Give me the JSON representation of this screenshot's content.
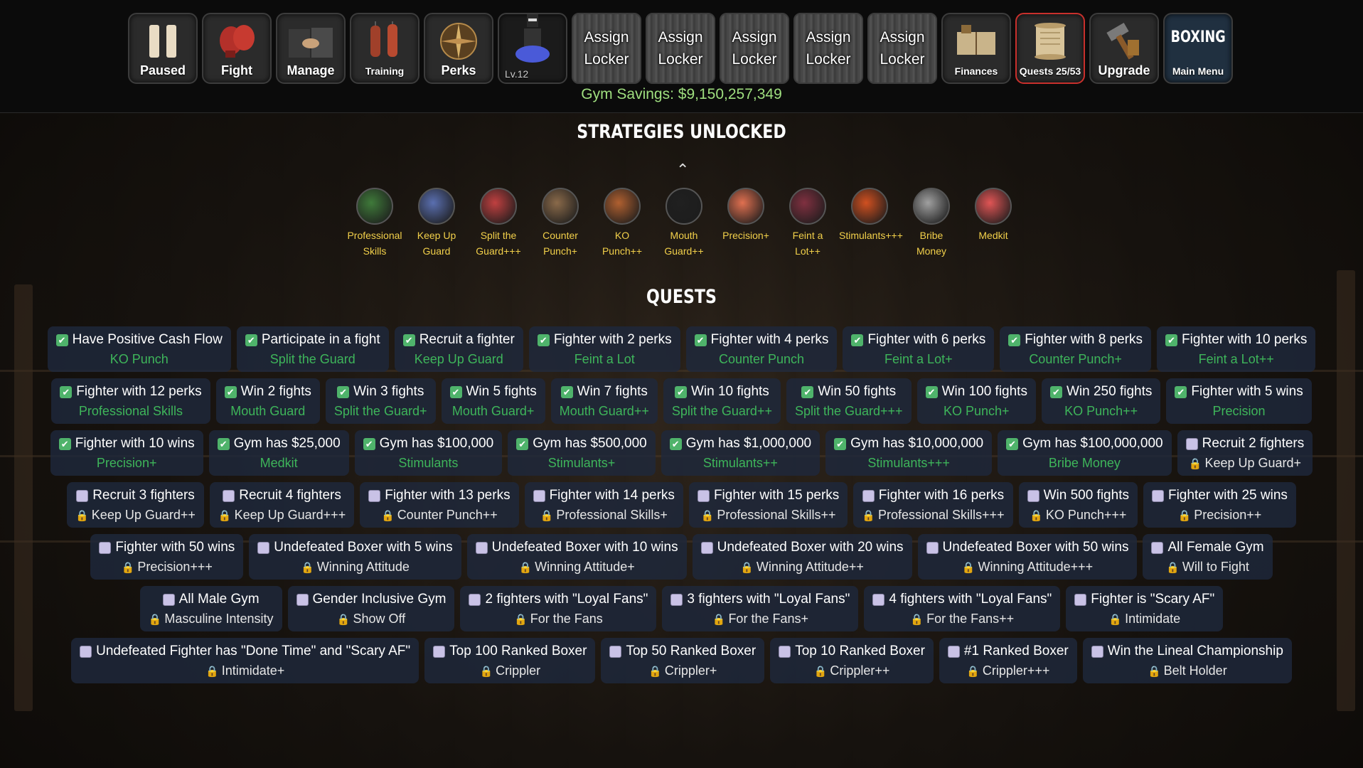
{
  "topbar": {
    "paused_label": "Paused",
    "fight_label": "Fight",
    "manage_label": "Manage",
    "training_label": "Training",
    "perks_label": "Perks",
    "level_label": "Lv.12",
    "locker_label": "Assign Locker",
    "finances_label": "Finances",
    "quests_label": "Quests 25/53",
    "upgrade_label": "Upgrade",
    "main_menu_label": "Main Menu",
    "logo_text": "BOXING",
    "savings": "Gym Savings: $9,150,257,349",
    "active_accent": "#c9302c"
  },
  "strategies": {
    "title": "STRATEGIES UNLOCKED",
    "caret": "^",
    "items": [
      {
        "line1": "Professional",
        "line2": "Skills",
        "color": "#3f7a3a"
      },
      {
        "line1": "Keep Up",
        "line2": "Guard",
        "color": "#5a6fb0"
      },
      {
        "line1": "Split the",
        "line2": "Guard+++",
        "color": "#c04040"
      },
      {
        "line1": "Counter",
        "line2": "Punch+",
        "color": "#8a6a4a"
      },
      {
        "line1": "KO",
        "line2": "Punch++",
        "color": "#b06030"
      },
      {
        "line1": "Mouth",
        "line2": "Guard++",
        "color": "#202020"
      },
      {
        "line1": "Precision+",
        "line2": "",
        "color": "#e07050"
      },
      {
        "line1": "Feint a",
        "line2": "Lot++",
        "color": "#803040"
      },
      {
        "line1": "Stimulants+++",
        "line2": "",
        "color": "#d05020"
      },
      {
        "line1": "Bribe",
        "line2": "Money",
        "color": "#a0a0a0"
      },
      {
        "line1": "Medkit",
        "line2": "",
        "color": "#e05555"
      }
    ]
  },
  "quests": {
    "title": "QUESTS",
    "rows": [
      [
        {
          "t": "Have Positive Cash Flow",
          "r": "KO Punch",
          "done": true
        },
        {
          "t": "Participate in a fight",
          "r": "Split the Guard",
          "done": true
        },
        {
          "t": "Recruit a fighter",
          "r": "Keep Up Guard",
          "done": true
        },
        {
          "t": "Fighter with 2 perks",
          "r": "Feint a Lot",
          "done": true
        },
        {
          "t": "Fighter with 4 perks",
          "r": "Counter Punch",
          "done": true
        },
        {
          "t": "Fighter with 6 perks",
          "r": "Feint a Lot+",
          "done": true
        },
        {
          "t": "Fighter with 8 perks",
          "r": "Counter Punch+",
          "done": true
        },
        {
          "t": "Fighter with 10 perks",
          "r": "Feint a Lot++",
          "done": true
        }
      ],
      [
        {
          "t": "Fighter with 12 perks",
          "r": "Professional Skills",
          "done": true
        },
        {
          "t": "Win 2 fights",
          "r": "Mouth Guard",
          "done": true
        },
        {
          "t": "Win 3 fights",
          "r": "Split the Guard+",
          "done": true
        },
        {
          "t": "Win 5 fights",
          "r": "Mouth Guard+",
          "done": true
        },
        {
          "t": "Win 7 fights",
          "r": "Mouth Guard++",
          "done": true
        },
        {
          "t": "Win 10 fights",
          "r": "Split the Guard++",
          "done": true
        },
        {
          "t": "Win 50 fights",
          "r": "Split the Guard+++",
          "done": true
        },
        {
          "t": "Win 100 fights",
          "r": "KO Punch+",
          "done": true
        },
        {
          "t": "Win 250 fights",
          "r": "KO Punch++",
          "done": true
        },
        {
          "t": "Fighter with 5 wins",
          "r": "Precision",
          "done": true
        }
      ],
      [
        {
          "t": "Fighter with 10 wins",
          "r": "Precision+",
          "done": true
        },
        {
          "t": "Gym has $25,000",
          "r": "Medkit",
          "done": true
        },
        {
          "t": "Gym has $100,000",
          "r": "Stimulants",
          "done": true
        },
        {
          "t": "Gym has $500,000",
          "r": "Stimulants+",
          "done": true
        },
        {
          "t": "Gym has $1,000,000",
          "r": "Stimulants++",
          "done": true
        },
        {
          "t": "Gym has $10,000,000",
          "r": "Stimulants+++",
          "done": true
        },
        {
          "t": "Gym has $100,000,000",
          "r": "Bribe Money",
          "done": true
        },
        {
          "t": "Recruit 2 fighters",
          "r": "Keep Up Guard+",
          "done": false
        }
      ],
      [
        {
          "t": "Recruit 3 fighters",
          "r": "Keep Up Guard++",
          "done": false
        },
        {
          "t": "Recruit 4 fighters",
          "r": "Keep Up Guard+++",
          "done": false
        },
        {
          "t": "Fighter with 13 perks",
          "r": "Counter Punch++",
          "done": false
        },
        {
          "t": "Fighter with 14 perks",
          "r": "Professional Skills+",
          "done": false
        },
        {
          "t": "Fighter with 15 perks",
          "r": "Professional Skills++",
          "done": false
        },
        {
          "t": "Fighter with 16 perks",
          "r": "Professional Skills+++",
          "done": false
        },
        {
          "t": "Win 500 fights",
          "r": "KO Punch+++",
          "done": false
        },
        {
          "t": "Fighter with 25 wins",
          "r": "Precision++",
          "done": false
        }
      ],
      [
        {
          "t": "Fighter with 50 wins",
          "r": "Precision+++",
          "done": false
        },
        {
          "t": "Undefeated Boxer with 5 wins",
          "r": "Winning Attitude",
          "done": false
        },
        {
          "t": "Undefeated Boxer with 10 wins",
          "r": "Winning Attitude+",
          "done": false
        },
        {
          "t": "Undefeated Boxer with 20 wins",
          "r": "Winning Attitude++",
          "done": false
        },
        {
          "t": "Undefeated Boxer with 50 wins",
          "r": "Winning Attitude+++",
          "done": false
        },
        {
          "t": "All Female Gym",
          "r": "Will to Fight",
          "done": false
        }
      ],
      [
        {
          "t": "All Male Gym",
          "r": "Masculine Intensity",
          "done": false
        },
        {
          "t": "Gender Inclusive Gym",
          "r": "Show Off",
          "done": false
        },
        {
          "t": "2 fighters with \"Loyal Fans\"",
          "r": "For the Fans",
          "done": false
        },
        {
          "t": "3 fighters with \"Loyal Fans\"",
          "r": "For the Fans+",
          "done": false
        },
        {
          "t": "4 fighters with \"Loyal Fans\"",
          "r": "For the Fans++",
          "done": false
        },
        {
          "t": "Fighter is \"Scary AF\"",
          "r": "Intimidate",
          "done": false
        }
      ],
      [
        {
          "t": "Undefeated Fighter has \"Done Time\" and \"Scary AF\"",
          "r": "Intimidate+",
          "done": false
        },
        {
          "t": "Top 100 Ranked Boxer",
          "r": "Crippler",
          "done": false
        },
        {
          "t": "Top 50 Ranked Boxer",
          "r": "Crippler+",
          "done": false
        },
        {
          "t": "Top 10 Ranked Boxer",
          "r": "Crippler++",
          "done": false
        },
        {
          "t": "#1 Ranked Boxer",
          "r": "Crippler+++",
          "done": false
        },
        {
          "t": "Win the Lineal Championship",
          "r": "Belt Holder",
          "done": false
        }
      ]
    ]
  }
}
